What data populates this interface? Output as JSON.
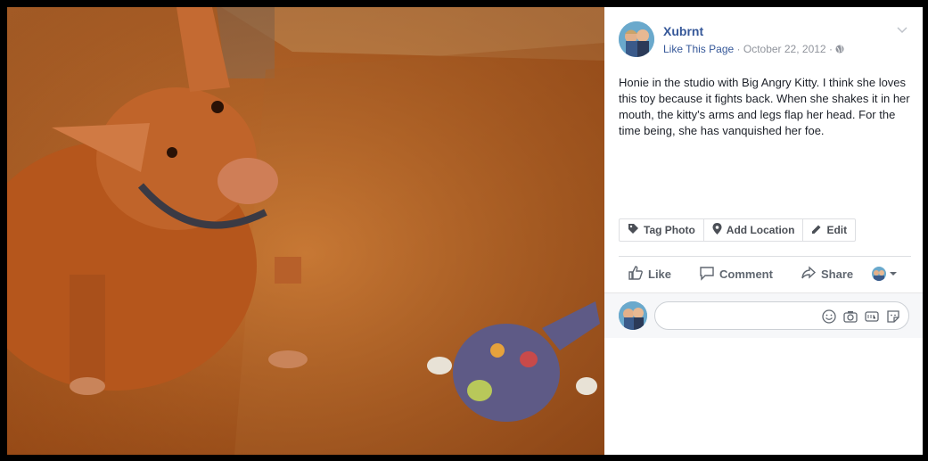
{
  "post": {
    "page_name": "Xubrnt",
    "like_page": "Like This Page",
    "date": "October 22, 2012",
    "separator": "·",
    "caption": "Honie in the studio with Big Angry Kitty. I think she loves this toy because it fights back. When she shakes it in her mouth, the kitty's arms and legs flap her head. For the time being, she has vanquished her foe."
  },
  "photo_actions": {
    "tag_photo": "Tag Photo",
    "add_location": "Add Location",
    "edit": "Edit"
  },
  "actions": {
    "like": "Like",
    "comment": "Comment",
    "share": "Share"
  },
  "icons": [
    "chevron-down-icon",
    "globe-icon",
    "tag-icon",
    "location-pin-icon",
    "pencil-icon",
    "thumbs-up-icon",
    "comment-icon",
    "share-icon",
    "emoji-icon",
    "camera-icon",
    "gif-icon",
    "sticker-icon"
  ],
  "colors": {
    "link": "#365899",
    "meta": "#90949c",
    "text": "#1d2129",
    "action": "#606770"
  }
}
